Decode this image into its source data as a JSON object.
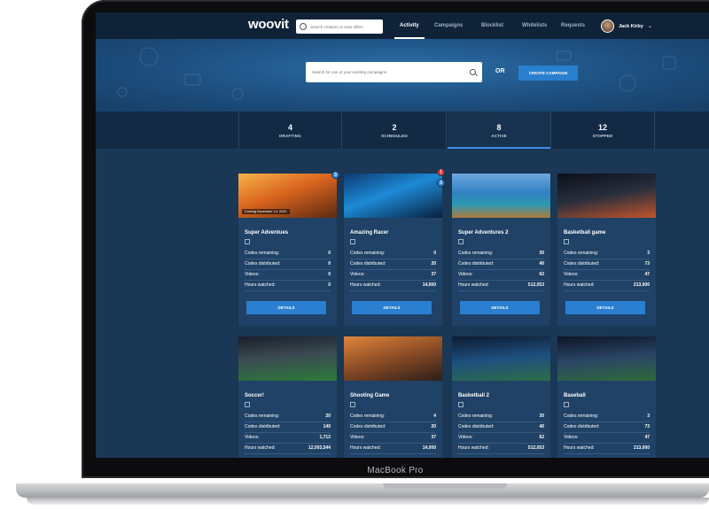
{
  "device": {
    "label": "MacBook Pro"
  },
  "nav": {
    "logo": "woovit",
    "search_placeholder": "Search creators or view offers",
    "links": [
      "Activity",
      "Campaigns",
      "Blocklist",
      "Whitelists",
      "Requests"
    ],
    "active_link": "Activity",
    "user_name": "Jack Kirby"
  },
  "hero": {
    "search_placeholder": "Search for one of your existing campaigns",
    "or_text": "OR",
    "create_button": "CREATE CAMPAIGN"
  },
  "tabs": [
    {
      "count": "4",
      "label": "DRAFTING"
    },
    {
      "count": "2",
      "label": "SCHEDULED"
    },
    {
      "count": "8",
      "label": "ACTIVE",
      "active": true
    },
    {
      "count": "12",
      "label": "STOPPED"
    }
  ],
  "stat_labels": [
    "Codes remaining:",
    "Codes distributed:",
    "Videos:",
    "Hours watched:"
  ],
  "details_label": "DETAILS",
  "campaigns": [
    {
      "title": "Super Adventues",
      "date_tag": "Coming November 14, 2020",
      "badge": "3",
      "stats": [
        "0",
        "0",
        "0",
        "0"
      ]
    },
    {
      "title": "Amazing Racer",
      "badge": "3",
      "alert": "!",
      "stats": [
        "0",
        "20",
        "37",
        "14,000"
      ]
    },
    {
      "title": "Super Adventures 2",
      "stats": [
        "30",
        "40",
        "62",
        "512,053"
      ]
    },
    {
      "title": "Basketball game",
      "stats": [
        "3",
        "73",
        "47",
        "213,000"
      ]
    },
    {
      "title": "Soccer!",
      "stats": [
        "20",
        "140",
        "1,712",
        "12,003,544"
      ]
    },
    {
      "title": "Shooting Game",
      "stats": [
        "4",
        "20",
        "37",
        "14,000"
      ]
    },
    {
      "title": "Basketball 2",
      "stats": [
        "30",
        "40",
        "62",
        "512,053"
      ]
    },
    {
      "title": "Baseball",
      "stats": [
        "3",
        "73",
        "47",
        "213,000"
      ]
    }
  ]
}
